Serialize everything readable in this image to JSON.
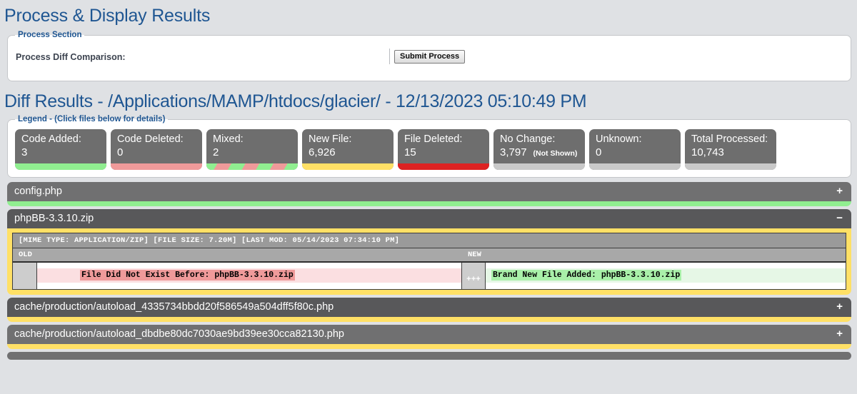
{
  "process": {
    "title": "Process & Display Results",
    "fieldset_legend": "Process Section",
    "label": "Process Diff Comparison:",
    "submit_label": "Submit Process"
  },
  "results": {
    "title": "Diff Results - /Applications/MAMP/htdocs/glacier/ - 12/13/2023 05:10:49 PM",
    "legend_caption": "Legend - (Click files below for details)",
    "stats": [
      {
        "label": "Code Added:",
        "value": "3",
        "note": "",
        "bar": "green"
      },
      {
        "label": "Code Deleted:",
        "value": "0",
        "note": "",
        "bar": "salmon"
      },
      {
        "label": "Mixed:",
        "value": "2",
        "note": "",
        "bar": "mixed"
      },
      {
        "label": "New File:",
        "value": "6,926",
        "note": "",
        "bar": "yellow"
      },
      {
        "label": "File Deleted:",
        "value": "15",
        "note": "",
        "bar": "red"
      },
      {
        "label": "No Change:",
        "value": "3,797",
        "note": "(Not Shown)",
        "bar": "gray"
      },
      {
        "label": "Unknown:",
        "value": "0",
        "note": "",
        "bar": "gray"
      },
      {
        "label": "Total Processed:",
        "value": "10,743",
        "note": "",
        "bar": "gray"
      }
    ]
  },
  "files": [
    {
      "name": "config.php",
      "toggle": "+",
      "bar": "green",
      "shade": "light"
    },
    {
      "name": "phpBB-3.3.10.zip",
      "toggle": "−",
      "bar": "yellow",
      "shade": "dark"
    },
    {
      "name": "cache/production/autoload_4335734bbdd20f586549a504dff5f80c.php",
      "toggle": "+",
      "bar": "yellow",
      "shade": "dark"
    },
    {
      "name": "cache/production/autoload_dbdbe80dc7030ae9bd39ee30cca82130.php",
      "toggle": "+",
      "bar": "yellow",
      "shade": "light"
    }
  ],
  "diff": {
    "meta": "[MIME TYPE: APPLICATION/ZIP] [FILE SIZE: 7.20M] [LAST MOD: 05/14/2023 07:34:10 PM]",
    "old_header": "OLD",
    "new_header": "NEW",
    "gutter_marker": "+++",
    "old_line": "File Did Not Exist Before: phpBB-3.3.10.zip",
    "new_line": "Brand New File Added: phpBB-3.3.10.zip"
  }
}
